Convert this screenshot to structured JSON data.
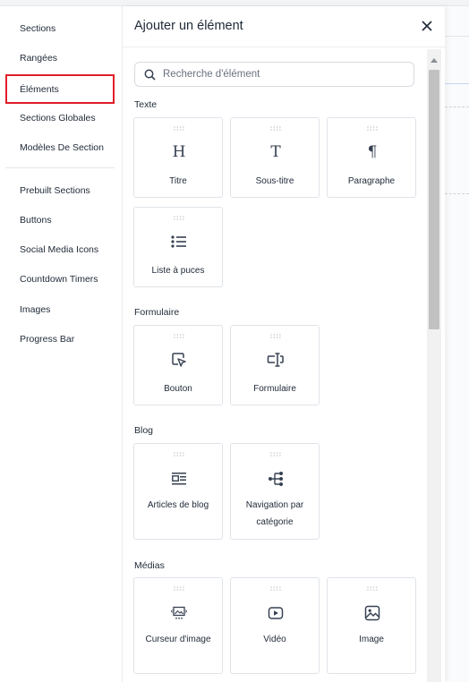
{
  "sidebar": {
    "items": [
      {
        "label": "Sections"
      },
      {
        "label": "Rangées"
      },
      {
        "label": "Éléments",
        "active": true
      },
      {
        "label": "Sections Globales"
      },
      {
        "label": "Modèles De Section"
      },
      {
        "label": "Prebuilt Sections"
      },
      {
        "label": "Buttons"
      },
      {
        "label": "Social Media Icons"
      },
      {
        "label": "Countdown Timers"
      },
      {
        "label": "Images"
      },
      {
        "label": "Progress Bar"
      }
    ],
    "active_border_color": "#e11d2a"
  },
  "panel": {
    "title": "Ajouter un élément",
    "close_icon": "close-icon",
    "search": {
      "placeholder": "Recherche d'élément",
      "value": "",
      "icon": "search-icon"
    },
    "categories": [
      {
        "label": "Texte",
        "elements": [
          {
            "label": "Titre",
            "icon": "heading-icon"
          },
          {
            "label": "Sous-titre",
            "icon": "subheading-icon"
          },
          {
            "label": "Paragraphe",
            "icon": "paragraph-icon"
          },
          {
            "label": "Liste à puces",
            "icon": "bullet-list-icon"
          }
        ]
      },
      {
        "label": "Formulaire",
        "elements": [
          {
            "label": "Bouton",
            "icon": "button-click-icon"
          },
          {
            "label": "Formulaire",
            "icon": "form-input-icon"
          }
        ]
      },
      {
        "label": "Blog",
        "elements": [
          {
            "label": "Articles de blog",
            "icon": "blog-posts-icon"
          },
          {
            "label": "Navigation par catégorie",
            "icon": "category-tree-icon"
          }
        ]
      },
      {
        "label": "Médias",
        "elements": [
          {
            "label": "Curseur d'image",
            "icon": "image-slider-icon"
          },
          {
            "label": "Vidéo",
            "icon": "video-icon"
          },
          {
            "label": "Image",
            "icon": "image-icon"
          }
        ]
      }
    ]
  },
  "colors": {
    "text": "#1f2937",
    "border": "#dfe3e8",
    "icon": "#374151",
    "grip": "#c4c8ce"
  }
}
